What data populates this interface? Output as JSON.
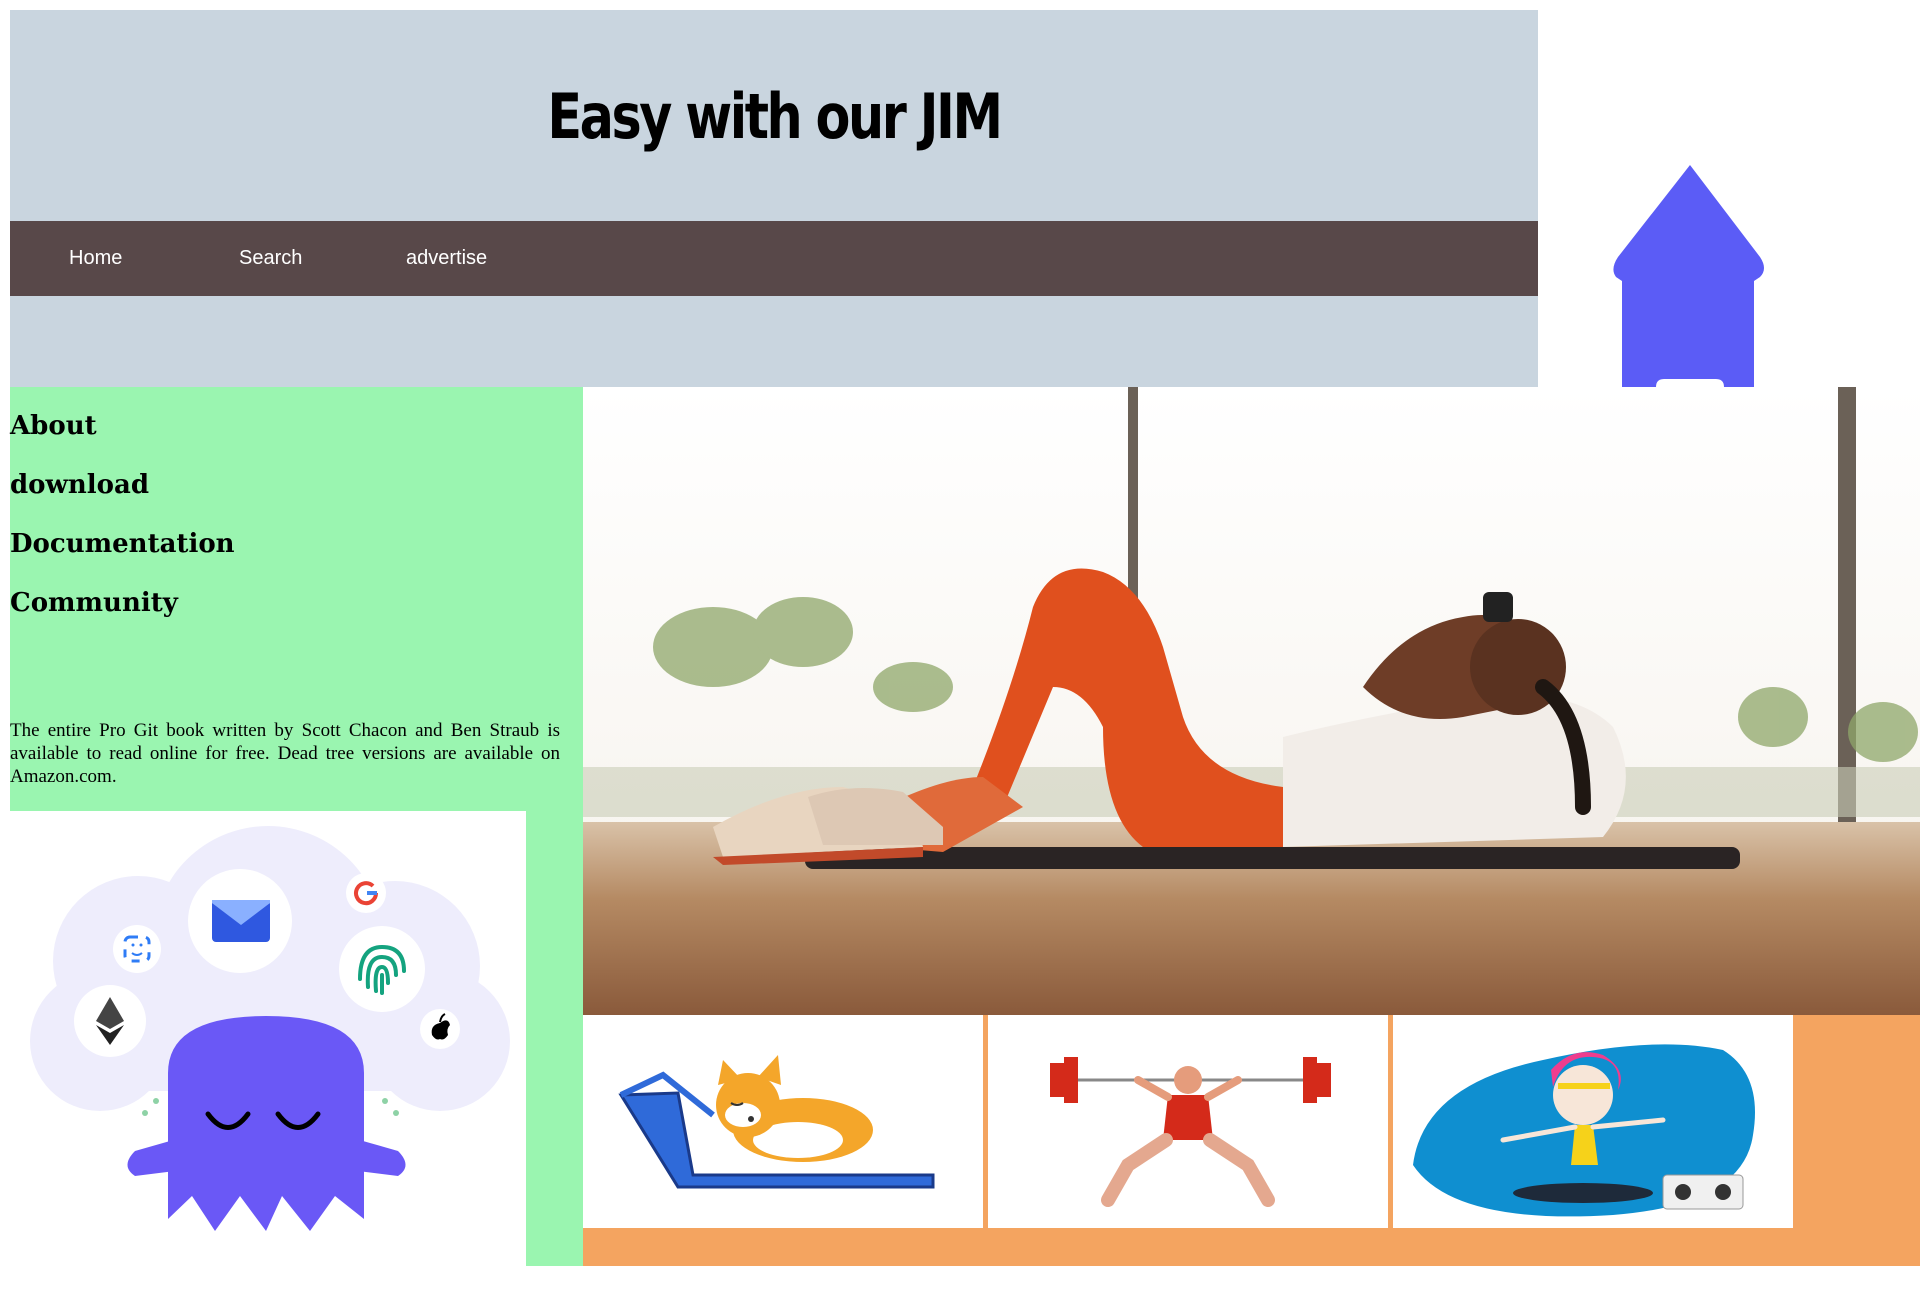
{
  "header": {
    "title": "Easy with our JIM",
    "nav": [
      "Home",
      "Search",
      "advertise"
    ]
  },
  "sidebar": {
    "links": [
      "About",
      "download",
      "Documentation",
      "Community"
    ],
    "description": "The entire Pro Git book written by Scott Chacon and Ben Straub is available to read online for free. Dead tree versions are available on Amazon.com."
  },
  "colors": {
    "header_bg": "#c9d5df",
    "nav_bg": "#584849",
    "sidebar_bg": "#9af5b0",
    "strip_bg": "#f4a460",
    "accent_purple": "#5b5cf6"
  },
  "icons": {
    "house": "house-icon",
    "ghost": "meditating-ghost-illustration",
    "mail": "mail-icon",
    "google": "google-icon",
    "fingerprint": "fingerprint-icon",
    "ethereum": "ethereum-icon",
    "apple": "apple-icon",
    "face-id": "face-id-icon"
  },
  "images": {
    "hero": "woman-doing-crunches-photo",
    "thumbs": [
      "corgi-treadmill-illustration",
      "weightlifter-illustration",
      "skateboard-dancer-illustration"
    ]
  }
}
